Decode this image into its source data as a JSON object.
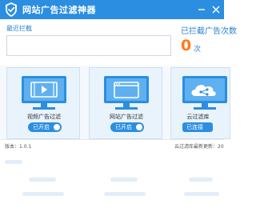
{
  "app": {
    "title": "网站广告过滤神器"
  },
  "recent": {
    "label": "最近拦截",
    "value": ""
  },
  "blocked": {
    "label": "已拦截广告次数",
    "count": "0",
    "unit": "次"
  },
  "cards": [
    {
      "label": "视频广告过滤",
      "toggle": "已开启",
      "enabled": true,
      "icon": "video-play-icon"
    },
    {
      "label": "网站广告过滤",
      "toggle": "已开启",
      "enabled": true,
      "icon": "browser-window-icon"
    },
    {
      "label": "云过滤库",
      "toggle": "已连接",
      "enabled": true,
      "icon": "cloud-share-icon"
    }
  ],
  "status": {
    "version": "版本：1.0.1",
    "cloud_update": "云过滤库最新更新：20"
  },
  "colors": {
    "accent": "#2b8ee0",
    "count": "#ff7a1a",
    "card_bg": "#e9f3fb"
  }
}
